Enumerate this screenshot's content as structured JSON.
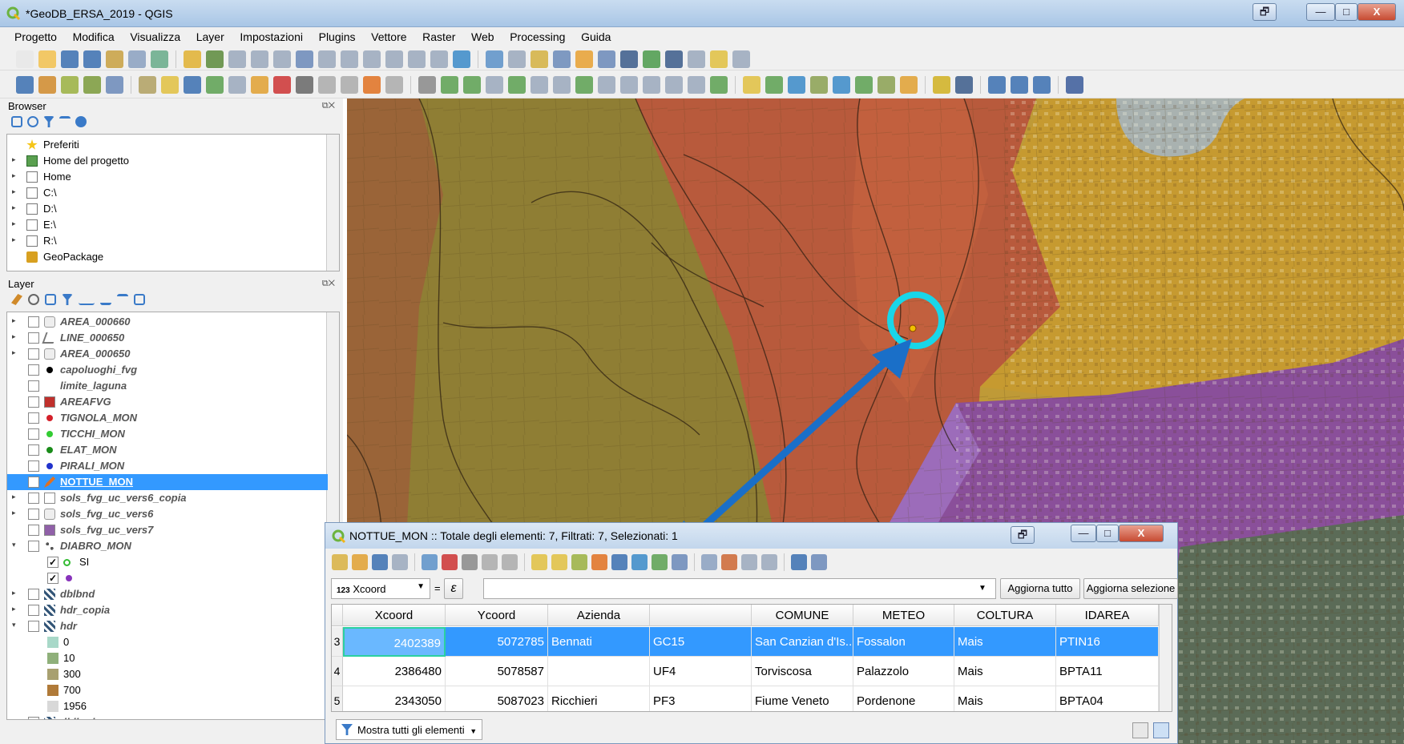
{
  "window": {
    "title": "*GeoDB_ERSA_2019 - QGIS",
    "controls": {
      "restore": "🗗",
      "minimize": "—",
      "maximize": "□",
      "close": "X"
    }
  },
  "menu": [
    "Progetto",
    "Modifica",
    "Visualizza",
    "Layer",
    "Impostazioni",
    "Plugins",
    "Vettore",
    "Raster",
    "Web",
    "Processing",
    "Guida"
  ],
  "browser": {
    "title": "Browser",
    "items": [
      {
        "label": "Preferiti",
        "icon": "star-icon",
        "expandable": false
      },
      {
        "label": "Home del progetto",
        "icon": "project-home-icon",
        "expandable": true
      },
      {
        "label": "Home",
        "icon": "home-folder-icon",
        "expandable": true
      },
      {
        "label": "C:\\",
        "icon": "drive-icon",
        "expandable": true
      },
      {
        "label": "D:\\",
        "icon": "drive-icon",
        "expandable": true
      },
      {
        "label": "E:\\",
        "icon": "drive-icon",
        "expandable": true
      },
      {
        "label": "R:\\",
        "icon": "drive-icon",
        "expandable": true
      },
      {
        "label": "GeoPackage",
        "icon": "geopackage-icon",
        "expandable": false
      }
    ]
  },
  "layers": {
    "title": "Layer",
    "items": [
      {
        "label": "AREA_000660",
        "expand": "▸",
        "checked": "",
        "icon": "polygon-layer-icon",
        "color": "#999999"
      },
      {
        "label": "LINE_000650",
        "expand": "▸",
        "checked": "",
        "icon": "line-layer-icon",
        "color": "#777777"
      },
      {
        "label": "AREA_000650",
        "expand": "▸",
        "checked": "",
        "icon": "polygon-layer-icon",
        "color": "#999999"
      },
      {
        "label": "capoluoghi_fvg",
        "expand": "",
        "checked": "",
        "icon": "point-icon",
        "color": "#000000"
      },
      {
        "label": "limite_laguna",
        "expand": "",
        "checked": "",
        "icon": "none",
        "color": ""
      },
      {
        "label": "AREAFVG",
        "expand": "",
        "checked": "",
        "icon": "fill-icon",
        "color": "#c0302c"
      },
      {
        "label": "TIGNOLA_MON",
        "expand": "",
        "checked": "",
        "icon": "point-icon",
        "color": "#d4202a"
      },
      {
        "label": "TICCHI_MON",
        "expand": "",
        "checked": "",
        "icon": "point-icon",
        "color": "#33cc33"
      },
      {
        "label": "ELAT_MON",
        "expand": "",
        "checked": "",
        "icon": "point-icon",
        "color": "#1a8c1a"
      },
      {
        "label": "PIRALI_MON",
        "expand": "",
        "checked": "",
        "icon": "point-icon",
        "color": "#2233cc"
      },
      {
        "label": "NOTTUE_MON",
        "expand": "",
        "checked": "✓",
        "icon": "pencil-edit-icon",
        "color": "#e07020",
        "selected": true
      },
      {
        "label": "sols_fvg_uc_vers6_copia",
        "expand": "▸",
        "checked": "",
        "icon": "fill-icon",
        "color": "#ffffff"
      },
      {
        "label": "sols_fvg_uc_vers6",
        "expand": "▸",
        "checked": "",
        "icon": "polygon-layer-icon",
        "color": "#999999"
      },
      {
        "label": "sols_fvg_uc_vers7",
        "expand": "",
        "checked": "",
        "icon": "fill-icon",
        "color": "#9060a8"
      },
      {
        "label": "DIABRO_MON",
        "expand": "▾",
        "checked": "",
        "icon": "multi-point-icon",
        "color": "#555555"
      },
      {
        "label": "SI",
        "expand": "",
        "checked": "✓",
        "icon": "ring-point-icon",
        "color": "#33bb33",
        "indent": true,
        "plain": true
      },
      {
        "label": "",
        "expand": "",
        "checked": "✓",
        "icon": "point-icon",
        "color": "#8833bb",
        "indent": true,
        "plain": true
      },
      {
        "label": "dblbnd",
        "expand": "▸",
        "checked": "",
        "icon": "raster-icon",
        "color": "#335577"
      },
      {
        "label": "hdr_copia",
        "expand": "▸",
        "checked": "",
        "icon": "raster-icon",
        "color": "#335577"
      },
      {
        "label": "hdr",
        "expand": "▾",
        "checked": "",
        "icon": "raster-icon",
        "color": "#335577"
      },
      {
        "label": "0",
        "legend": true,
        "color": "#a8d8c8"
      },
      {
        "label": "10",
        "legend": true,
        "color": "#8fb07a"
      },
      {
        "label": "300",
        "legend": true,
        "color": "#a8a070"
      },
      {
        "label": "700",
        "legend": true,
        "color": "#b07a38"
      },
      {
        "label": "1956",
        "legend": true,
        "color": "#d8d8d8"
      },
      {
        "label": "dblbnd",
        "expand": "▾",
        "checked": "",
        "icon": "raster-icon",
        "color": "#335577"
      }
    ]
  },
  "attribute_table": {
    "title": "NOTTUE_MON :: Totale degli elementi: 7, Filtrati: 7, Selezionati: 1",
    "field_selector": "Xcoord",
    "field_prefix": "123",
    "equals": "=",
    "epsilon": "ε",
    "expression_value": "",
    "update_all": "Aggiorna tutto",
    "update_selection": "Aggiorna selezione",
    "columns": [
      "Xcoord",
      "Ycoord",
      "Azienda",
      "",
      "COMUNE",
      "METEO",
      "COLTURA",
      "IDAREA"
    ],
    "rows": [
      {
        "n": "3",
        "cells": [
          "2402389",
          "5072785",
          "Bennati",
          "GC15",
          "San Canzian d'Is...",
          "Fossalon",
          "Mais",
          "PTIN16"
        ],
        "selected": true
      },
      {
        "n": "4",
        "cells": [
          "2386480",
          "5078587",
          "",
          "UF4",
          "Torviscosa",
          "Palazzolo",
          "Mais",
          "BPTA11"
        ],
        "extra": "F"
      },
      {
        "n": "5",
        "cells": [
          "2343050",
          "5087023",
          "Ricchieri",
          "PF3",
          "Fiume Veneto",
          "Pordenone",
          "Mais",
          "BPTA04"
        ],
        "extra": "F"
      }
    ],
    "show_all": "Mostra tutti gli elementi"
  },
  "colors": {
    "selection": "#3399ff",
    "highlight_circle": "#19d6e8",
    "arrow": "#1a6fc8"
  }
}
